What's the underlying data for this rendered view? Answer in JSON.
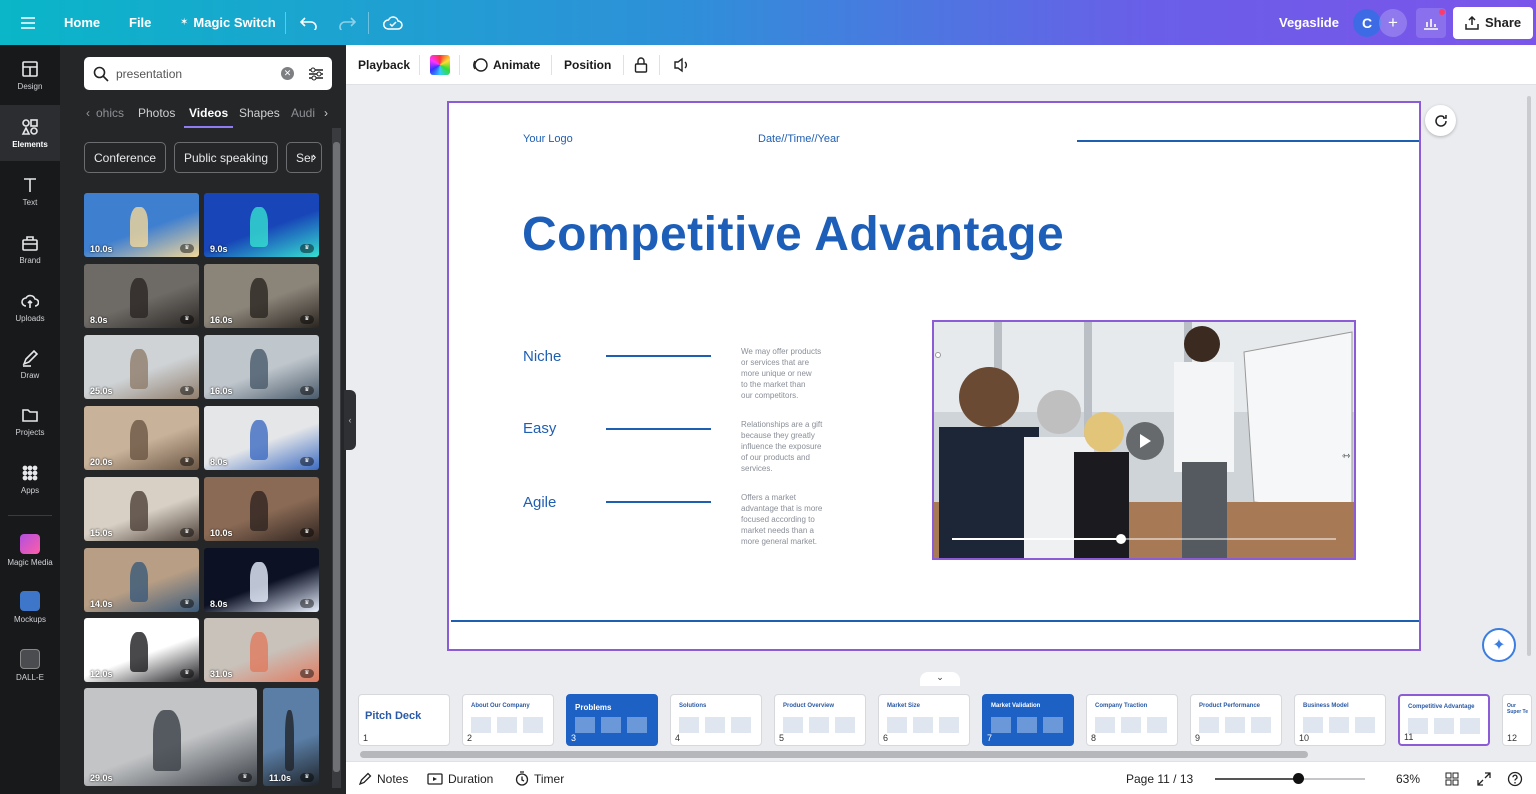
{
  "topbar": {
    "menu_icon": "hamburger-icon",
    "home": "Home",
    "file": "File",
    "magic_switch": "Magic Switch",
    "project_name": "Vegaslide",
    "avatar_letter": "C",
    "share": "Share"
  },
  "rail": [
    {
      "label": "Design",
      "icon": "layout-icon"
    },
    {
      "label": "Elements",
      "icon": "shapes-icon"
    },
    {
      "label": "Text",
      "icon": "text-icon"
    },
    {
      "label": "Brand",
      "icon": "briefcase-icon"
    },
    {
      "label": "Uploads",
      "icon": "cloud-upload-icon"
    },
    {
      "label": "Draw",
      "icon": "pen-icon"
    },
    {
      "label": "Projects",
      "icon": "folder-icon"
    },
    {
      "label": "Apps",
      "icon": "grid-icon"
    },
    {
      "label": "Magic Media",
      "icon": "magic-media-icon"
    },
    {
      "label": "Mockups",
      "icon": "mockups-icon"
    },
    {
      "label": "DALL-E",
      "icon": "dalle-icon"
    }
  ],
  "panel": {
    "search_value": "presentation",
    "tabs": [
      "ohics",
      "Photos",
      "Videos",
      "Shapes",
      "Audi"
    ],
    "active_tab": "Videos",
    "chips": [
      "Conference",
      "Public speaking",
      "Ser"
    ],
    "videos": [
      {
        "duration": "10.0s"
      },
      {
        "duration": "9.0s"
      },
      {
        "duration": "8.0s"
      },
      {
        "duration": "16.0s"
      },
      {
        "duration": "25.0s"
      },
      {
        "duration": "16.0s"
      },
      {
        "duration": "20.0s"
      },
      {
        "duration": "8.0s"
      },
      {
        "duration": "15.0s"
      },
      {
        "duration": "10.0s"
      },
      {
        "duration": "14.0s"
      },
      {
        "duration": "8.0s"
      },
      {
        "duration": "12.0s"
      },
      {
        "duration": "31.0s"
      },
      {
        "duration": "29.0s"
      },
      {
        "duration": "11.0s"
      }
    ]
  },
  "context_toolbar": {
    "playback": "Playback",
    "animate": "Animate",
    "position": "Position"
  },
  "slide": {
    "logo": "Your Logo",
    "date": "Date//Time//Year",
    "title": "Competitive Advantage",
    "items": [
      {
        "label": "Niche",
        "text": [
          "We may offer products",
          "or services that are",
          "more unique or new",
          "to the market than",
          "our competitors."
        ]
      },
      {
        "label": "Easy",
        "text": [
          "Relationships are a gift",
          "because they greatly",
          "influence the exposure",
          "of our products and",
          "services."
        ]
      },
      {
        "label": "Agile",
        "text": [
          "Offers a market",
          "advantage that is more",
          "focused according to",
          "market needs than a",
          "more general market."
        ]
      }
    ],
    "video_progress": 0.44
  },
  "thumbnails": [
    {
      "num": "1",
      "title": "Pitch Deck",
      "dark": false
    },
    {
      "num": "2",
      "title": "About Our Company",
      "dark": false
    },
    {
      "num": "3",
      "title": "Problems",
      "dark": true
    },
    {
      "num": "4",
      "title": "Solutions",
      "dark": false
    },
    {
      "num": "5",
      "title": "Product Overview",
      "dark": false
    },
    {
      "num": "6",
      "title": "Market Size",
      "dark": false
    },
    {
      "num": "7",
      "title": "Market Validation",
      "dark": true
    },
    {
      "num": "8",
      "title": "Company Traction",
      "dark": false
    },
    {
      "num": "9",
      "title": "Product Performance",
      "dark": false
    },
    {
      "num": "10",
      "title": "Business Model",
      "dark": false
    },
    {
      "num": "11",
      "title": "Competitive Advantage",
      "dark": false
    },
    {
      "num": "12",
      "title": "Our Super Te",
      "dark": false
    }
  ],
  "footer": {
    "notes": "Notes",
    "duration": "Duration",
    "timer": "Timer",
    "page": "Page 11 / 13",
    "zoom": "63%",
    "zoom_level": 0.55
  },
  "colors": {
    "accent": "#1f5fb2",
    "selection": "#8b5cd6"
  }
}
